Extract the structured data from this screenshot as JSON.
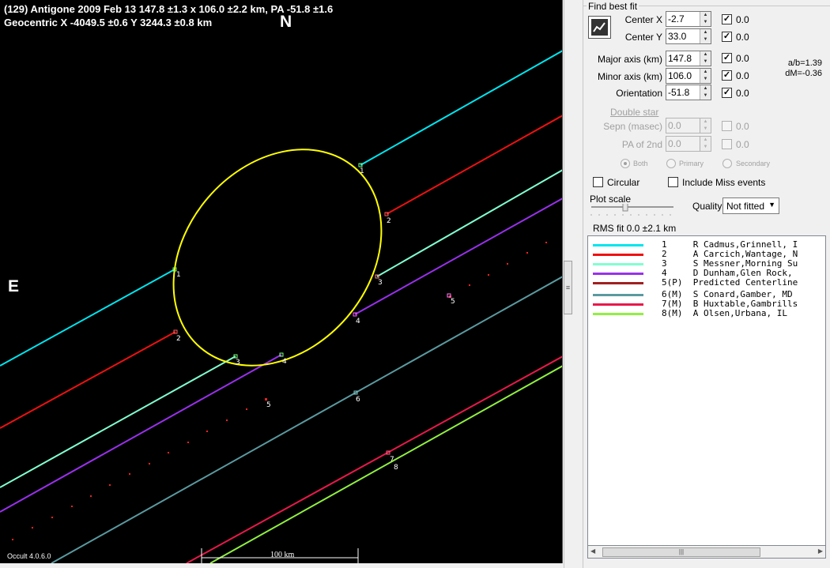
{
  "header": {
    "line1": "(129) Antigone  2009 Feb 13   147.8 ±1.3 x 106.0 ±2.2 km, PA -51.8 ±1.6",
    "line2": "Geocentric  X  -4049.5 ±0.6  Y 3244.3 ±0.8 km"
  },
  "plot": {
    "north_label": "N",
    "east_label": "E",
    "version": "Occult 4.0.6.0",
    "scale_label": "100 km",
    "chord_labels": [
      "1",
      "2",
      "3",
      "4",
      "5",
      "6",
      "7",
      "8"
    ]
  },
  "panel": {
    "find_best_fit": "Find best fit",
    "center_x_label": "Center X",
    "center_x_value": "-2.7",
    "center_x_unc": "0.0",
    "center_y_label": "Center Y",
    "center_y_value": "33.0",
    "center_y_unc": "0.0",
    "major_label": "Major axis (km)",
    "major_value": "147.8",
    "major_unc": "0.0",
    "minor_label": "Minor axis (km)",
    "minor_value": "106.0",
    "minor_unc": "0.0",
    "orient_label": "Orientation",
    "orient_value": "-51.8",
    "orient_unc": "0.0",
    "ab_ratio": "a/b=1.39",
    "dm": "dM=-0.36",
    "double_star": "Double star",
    "sepn_label": "Sepn (masec)",
    "sepn_value": "0.0",
    "sepn_unc": "0.0",
    "pa2_label": "PA of 2nd",
    "pa2_value": "0.0",
    "pa2_unc": "0.0",
    "radio_both": "Both",
    "radio_primary": "Primary",
    "radio_secondary": "Secondary",
    "circular_label": "Circular",
    "include_miss_label": "Include Miss events",
    "plot_scale_label": "Plot scale",
    "quality_label": "Quality",
    "quality_value": "Not fitted",
    "rms_fit": "RMS fit  0.0 ±2.1 km"
  },
  "legend": [
    {
      "text": "1     R Cadmus,Grinnell, I",
      "color": "#00e5ee"
    },
    {
      "text": "2     A Carcich,Wantage, N",
      "color": "#ee1111"
    },
    {
      "text": "3     S Messner,Morning Su",
      "color": "#80ffd0"
    },
    {
      "text": "4     D Dunham,Glen Rock,",
      "color": "#9a30ee"
    },
    {
      "text": "5(P)  Predicted Centerline",
      "color": "#a02020"
    },
    {
      "text": "6(M)  S Conard,Gamber, MD",
      "color": "#5a9aa0"
    },
    {
      "text": "7(M)  B Huxtable,Gambrills",
      "color": "#e8194a"
    },
    {
      "text": "8(M)  A Olsen,Urbana, IL",
      "color": "#90f040"
    }
  ]
}
